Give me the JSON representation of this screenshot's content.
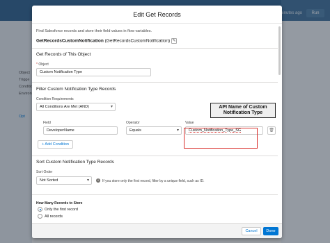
{
  "background": {
    "timestamp": "minutes ago",
    "run_label": "Run",
    "left_labels": [
      "Object",
      "Trigge",
      "Condition",
      "Environ",
      "Opt"
    ]
  },
  "modal": {
    "title": "Edit Get Records",
    "intro": "Find Salesforce records and store their field values in flow variables.",
    "label_bold": "GetRecordsCustomNotification",
    "api_name": "(GetRecordsCustomNotification)"
  },
  "object_section": {
    "title": "Get Records of This Object",
    "object_label": "Object",
    "object_value": "Custom Notification Type"
  },
  "filter_section": {
    "title": "Filter Custom Notification Type Records",
    "condition_req_label": "Condition Requirements",
    "condition_req_value": "All Conditions Are Met (AND)",
    "field_label": "Field",
    "field_value": "DeveloperName",
    "operator_label": "Operator",
    "operator_value": "Equals",
    "value_label": "Value",
    "value_value": "Custom_Notification_Type_SG",
    "add_condition": "+ Add Condition",
    "callout_line1": "API Name of Custom",
    "callout_line2": "Notification  Type"
  },
  "sort_section": {
    "title": "Sort Custom Notification Type Records",
    "sort_order_label": "Sort Order",
    "sort_order_value": "Not Sorted",
    "hint": "If you store only the first record, filter by a unique field, such as ID."
  },
  "store_section": {
    "title": "How Many Records to Store",
    "option1": "Only the first record",
    "option2": "All records"
  },
  "footer": {
    "cancel": "Cancel",
    "done": "Done"
  }
}
